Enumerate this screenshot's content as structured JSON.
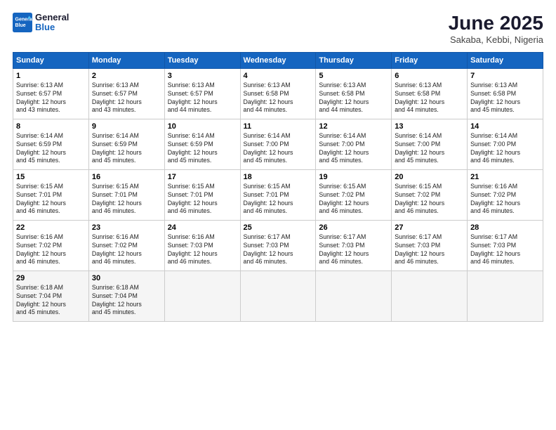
{
  "header": {
    "logo_line1": "General",
    "logo_line2": "Blue",
    "title": "June 2025",
    "subtitle": "Sakaba, Kebbi, Nigeria"
  },
  "calendar": {
    "days_of_week": [
      "Sunday",
      "Monday",
      "Tuesday",
      "Wednesday",
      "Thursday",
      "Friday",
      "Saturday"
    ],
    "weeks": [
      [
        {
          "day": "1",
          "sunrise": "Sunrise: 6:13 AM",
          "sunset": "Sunset: 6:57 PM",
          "daylight": "Daylight: 12 hours",
          "minutes": "and 43 minutes."
        },
        {
          "day": "2",
          "sunrise": "Sunrise: 6:13 AM",
          "sunset": "Sunset: 6:57 PM",
          "daylight": "Daylight: 12 hours",
          "minutes": "and 43 minutes."
        },
        {
          "day": "3",
          "sunrise": "Sunrise: 6:13 AM",
          "sunset": "Sunset: 6:57 PM",
          "daylight": "Daylight: 12 hours",
          "minutes": "and 44 minutes."
        },
        {
          "day": "4",
          "sunrise": "Sunrise: 6:13 AM",
          "sunset": "Sunset: 6:58 PM",
          "daylight": "Daylight: 12 hours",
          "minutes": "and 44 minutes."
        },
        {
          "day": "5",
          "sunrise": "Sunrise: 6:13 AM",
          "sunset": "Sunset: 6:58 PM",
          "daylight": "Daylight: 12 hours",
          "minutes": "and 44 minutes."
        },
        {
          "day": "6",
          "sunrise": "Sunrise: 6:13 AM",
          "sunset": "Sunset: 6:58 PM",
          "daylight": "Daylight: 12 hours",
          "minutes": "and 44 minutes."
        },
        {
          "day": "7",
          "sunrise": "Sunrise: 6:13 AM",
          "sunset": "Sunset: 6:58 PM",
          "daylight": "Daylight: 12 hours",
          "minutes": "and 45 minutes."
        }
      ],
      [
        {
          "day": "8",
          "sunrise": "Sunrise: 6:14 AM",
          "sunset": "Sunset: 6:59 PM",
          "daylight": "Daylight: 12 hours",
          "minutes": "and 45 minutes."
        },
        {
          "day": "9",
          "sunrise": "Sunrise: 6:14 AM",
          "sunset": "Sunset: 6:59 PM",
          "daylight": "Daylight: 12 hours",
          "minutes": "and 45 minutes."
        },
        {
          "day": "10",
          "sunrise": "Sunrise: 6:14 AM",
          "sunset": "Sunset: 6:59 PM",
          "daylight": "Daylight: 12 hours",
          "minutes": "and 45 minutes."
        },
        {
          "day": "11",
          "sunrise": "Sunrise: 6:14 AM",
          "sunset": "Sunset: 7:00 PM",
          "daylight": "Daylight: 12 hours",
          "minutes": "and 45 minutes."
        },
        {
          "day": "12",
          "sunrise": "Sunrise: 6:14 AM",
          "sunset": "Sunset: 7:00 PM",
          "daylight": "Daylight: 12 hours",
          "minutes": "and 45 minutes."
        },
        {
          "day": "13",
          "sunrise": "Sunrise: 6:14 AM",
          "sunset": "Sunset: 7:00 PM",
          "daylight": "Daylight: 12 hours",
          "minutes": "and 45 minutes."
        },
        {
          "day": "14",
          "sunrise": "Sunrise: 6:14 AM",
          "sunset": "Sunset: 7:00 PM",
          "daylight": "Daylight: 12 hours",
          "minutes": "and 46 minutes."
        }
      ],
      [
        {
          "day": "15",
          "sunrise": "Sunrise: 6:15 AM",
          "sunset": "Sunset: 7:01 PM",
          "daylight": "Daylight: 12 hours",
          "minutes": "and 46 minutes."
        },
        {
          "day": "16",
          "sunrise": "Sunrise: 6:15 AM",
          "sunset": "Sunset: 7:01 PM",
          "daylight": "Daylight: 12 hours",
          "minutes": "and 46 minutes."
        },
        {
          "day": "17",
          "sunrise": "Sunrise: 6:15 AM",
          "sunset": "Sunset: 7:01 PM",
          "daylight": "Daylight: 12 hours",
          "minutes": "and 46 minutes."
        },
        {
          "day": "18",
          "sunrise": "Sunrise: 6:15 AM",
          "sunset": "Sunset: 7:01 PM",
          "daylight": "Daylight: 12 hours",
          "minutes": "and 46 minutes."
        },
        {
          "day": "19",
          "sunrise": "Sunrise: 6:15 AM",
          "sunset": "Sunset: 7:02 PM",
          "daylight": "Daylight: 12 hours",
          "minutes": "and 46 minutes."
        },
        {
          "day": "20",
          "sunrise": "Sunrise: 6:15 AM",
          "sunset": "Sunset: 7:02 PM",
          "daylight": "Daylight: 12 hours",
          "minutes": "and 46 minutes."
        },
        {
          "day": "21",
          "sunrise": "Sunrise: 6:16 AM",
          "sunset": "Sunset: 7:02 PM",
          "daylight": "Daylight: 12 hours",
          "minutes": "and 46 minutes."
        }
      ],
      [
        {
          "day": "22",
          "sunrise": "Sunrise: 6:16 AM",
          "sunset": "Sunset: 7:02 PM",
          "daylight": "Daylight: 12 hours",
          "minutes": "and 46 minutes."
        },
        {
          "day": "23",
          "sunrise": "Sunrise: 6:16 AM",
          "sunset": "Sunset: 7:02 PM",
          "daylight": "Daylight: 12 hours",
          "minutes": "and 46 minutes."
        },
        {
          "day": "24",
          "sunrise": "Sunrise: 6:16 AM",
          "sunset": "Sunset: 7:03 PM",
          "daylight": "Daylight: 12 hours",
          "minutes": "and 46 minutes."
        },
        {
          "day": "25",
          "sunrise": "Sunrise: 6:17 AM",
          "sunset": "Sunset: 7:03 PM",
          "daylight": "Daylight: 12 hours",
          "minutes": "and 46 minutes."
        },
        {
          "day": "26",
          "sunrise": "Sunrise: 6:17 AM",
          "sunset": "Sunset: 7:03 PM",
          "daylight": "Daylight: 12 hours",
          "minutes": "and 46 minutes."
        },
        {
          "day": "27",
          "sunrise": "Sunrise: 6:17 AM",
          "sunset": "Sunset: 7:03 PM",
          "daylight": "Daylight: 12 hours",
          "minutes": "and 46 minutes."
        },
        {
          "day": "28",
          "sunrise": "Sunrise: 6:17 AM",
          "sunset": "Sunset: 7:03 PM",
          "daylight": "Daylight: 12 hours",
          "minutes": "and 46 minutes."
        }
      ],
      [
        {
          "day": "29",
          "sunrise": "Sunrise: 6:18 AM",
          "sunset": "Sunset: 7:04 PM",
          "daylight": "Daylight: 12 hours",
          "minutes": "and 45 minutes."
        },
        {
          "day": "30",
          "sunrise": "Sunrise: 6:18 AM",
          "sunset": "Sunset: 7:04 PM",
          "daylight": "Daylight: 12 hours",
          "minutes": "and 45 minutes."
        },
        null,
        null,
        null,
        null,
        null
      ]
    ]
  }
}
